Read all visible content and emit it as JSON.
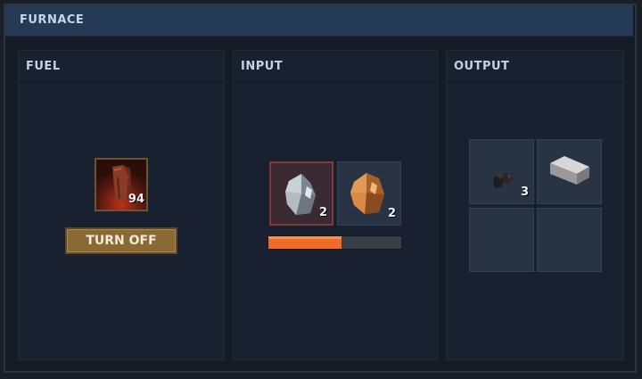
{
  "window": {
    "title": "FURNACE"
  },
  "fuel": {
    "header": "FUEL",
    "item_icon": "wood-log-icon",
    "count": "94",
    "button_label": "TURN OFF"
  },
  "input": {
    "header": "INPUT",
    "slots": [
      {
        "icon": "silver-ore-icon",
        "count": "2",
        "active": true
      },
      {
        "icon": "copper-ore-icon",
        "count": "2",
        "active": false
      }
    ],
    "progress": 0.55,
    "progress_color": "#f06a2a"
  },
  "output": {
    "header": "OUTPUT",
    "slots": [
      {
        "icon": "coal-icon",
        "count": "3"
      },
      {
        "icon": "metal-bar-icon",
        "count": ""
      },
      {
        "icon": "empty",
        "count": ""
      },
      {
        "icon": "empty",
        "count": ""
      }
    ]
  }
}
